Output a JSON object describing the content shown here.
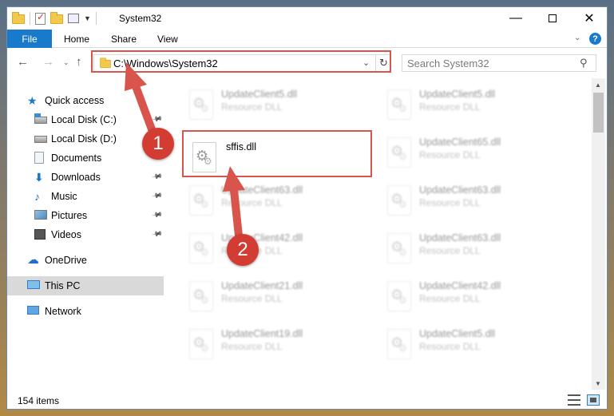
{
  "window": {
    "title": "System32",
    "controls": {
      "minimize": "—",
      "maximize": "",
      "close": "✕"
    }
  },
  "ribbon": {
    "tabs": {
      "file": "File",
      "home": "Home",
      "share": "Share",
      "view": "View"
    },
    "help": "?"
  },
  "navigation": {
    "address": "C:\\Windows\\System32",
    "search_placeholder": "Search System32"
  },
  "sidebar": {
    "items": [
      {
        "label": "Quick access",
        "icon": "star-icon"
      },
      {
        "label": "Local Disk (C:)",
        "icon": "drive-icon"
      },
      {
        "label": "Local Disk (D:)",
        "icon": "drive-icon"
      },
      {
        "label": "Documents",
        "icon": "document-icon"
      },
      {
        "label": "Downloads",
        "icon": "download-icon"
      },
      {
        "label": "Music",
        "icon": "music-icon"
      },
      {
        "label": "Pictures",
        "icon": "pictures-icon"
      },
      {
        "label": "Videos",
        "icon": "video-icon"
      },
      {
        "label": "OneDrive",
        "icon": "cloud-icon"
      },
      {
        "label": "This PC",
        "icon": "computer-icon"
      },
      {
        "label": "Network",
        "icon": "network-icon"
      }
    ],
    "selected": "This PC"
  },
  "files": [
    {
      "name": "UpdateClient5.dll",
      "type": "Resource DLL"
    },
    {
      "name": "UpdateClient5.dll",
      "type": "Resource DLL"
    },
    {
      "name": "sffis.dll",
      "type": ""
    },
    {
      "name": "UpdateClient65.dll",
      "type": "Resource DLL"
    },
    {
      "name": "UpdateClient63.dll",
      "type": "Resource DLL"
    },
    {
      "name": "UpdateClient63.dll",
      "type": "Resource DLL"
    },
    {
      "name": "UpdateClient42.dll",
      "type": "Resource DLL"
    },
    {
      "name": "UpdateClient63.dll",
      "type": "Resource DLL"
    },
    {
      "name": "UpdateClient21.dll",
      "type": "Resource DLL"
    },
    {
      "name": "UpdateClient42.dll",
      "type": "Resource DLL"
    },
    {
      "name": "UpdateClient19.dll",
      "type": "Resource DLL"
    },
    {
      "name": "UpdateClient5.dll",
      "type": "Resource DLL"
    }
  ],
  "status": {
    "item_count": "154 items"
  },
  "annotations": {
    "step1": "1",
    "step2": "2",
    "color": "#d8544c"
  }
}
